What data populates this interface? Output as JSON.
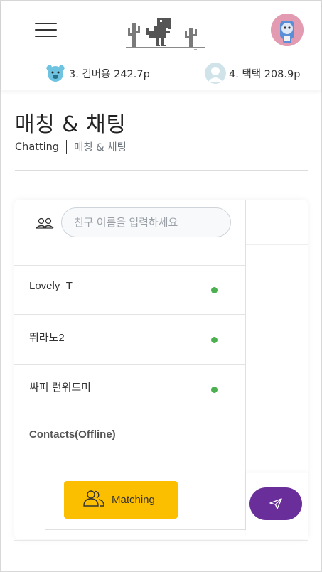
{
  "header": {
    "menu_icon": "hamburger-menu-icon",
    "logo_icon": "dino-logo-icon",
    "profile_icon": "user-avatar-icon",
    "rankings": [
      {
        "rank_text": "3. 김머용 242.7p",
        "icon": "bear-avatar-icon"
      },
      {
        "rank_text": "4. 택택 208.9p",
        "icon": "person-avatar-icon"
      }
    ]
  },
  "page": {
    "title": "매칭 & 채팅",
    "breadcrumb": [
      "Chatting",
      "매칭 & 채팅"
    ]
  },
  "chat": {
    "search": {
      "placeholder": "친구 이름을 입력하세요",
      "value": "",
      "icon": "friends-icon"
    },
    "online_contacts": [
      {
        "name": "Lovely_T",
        "status": "online"
      },
      {
        "name": "뛰라노2",
        "status": "online"
      },
      {
        "name": "싸피 런위드미",
        "status": "online"
      }
    ],
    "offline_header": "Contacts(Offline)",
    "matching_button": {
      "label": "Matching",
      "icon": "users-icon"
    },
    "send_button": {
      "icon": "paper-plane-icon"
    }
  },
  "colors": {
    "online": "#4caf50",
    "matching_bg": "#fcbf00",
    "send_bg": "#6a2e9b",
    "avatar_pink": "#e39bb2"
  }
}
